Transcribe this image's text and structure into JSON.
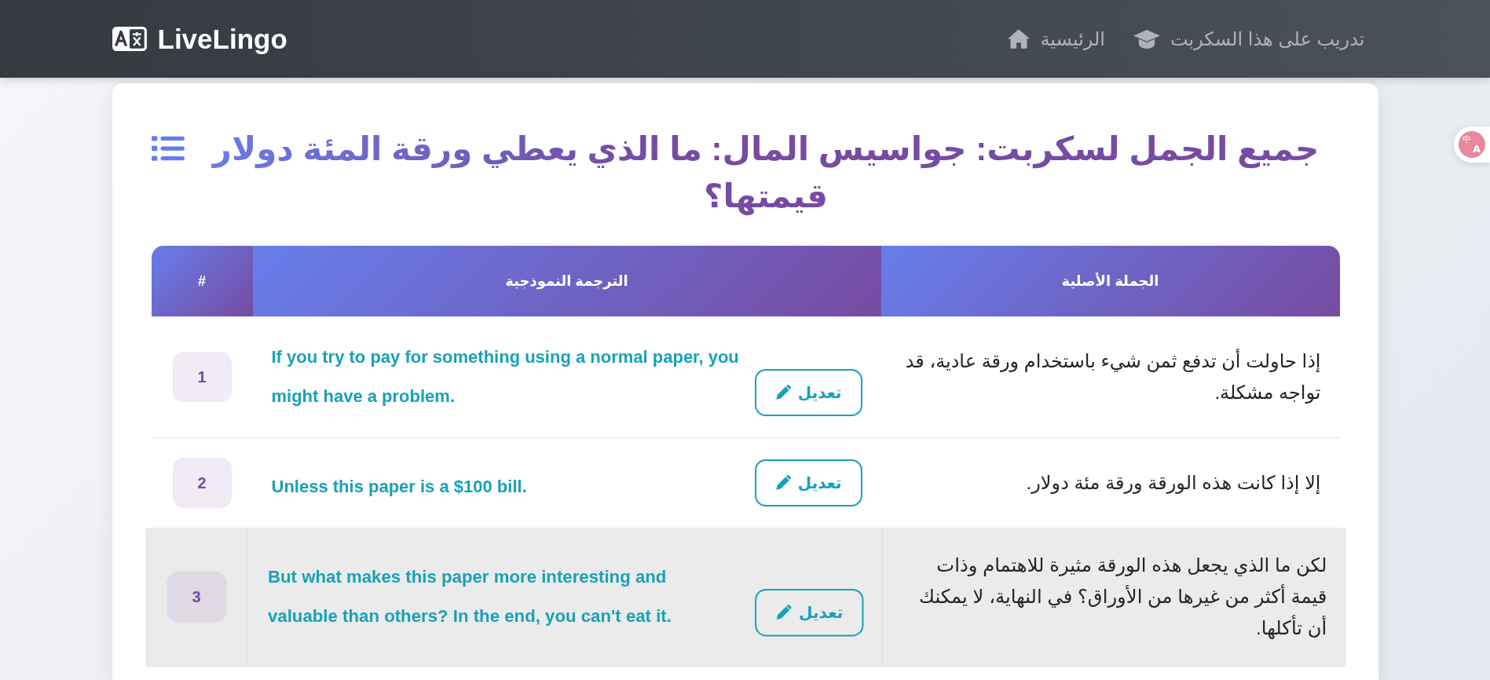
{
  "navbar": {
    "brand": "LiveLingo",
    "links": [
      {
        "kind": "training",
        "label": "تدريب على هذا السكربت"
      },
      {
        "kind": "home",
        "label": "الرئيسية"
      }
    ]
  },
  "page": {
    "title": "جميع الجمل لسكربت: جواسيس المال: ما الذي يعطي ورقة المئة دولار قيمتها؟"
  },
  "table": {
    "columns": [
      "الجملة الأصلية",
      "الترجمة النموذجية",
      "#"
    ],
    "rows": [
      {
        "number": "1",
        "original": "إذا حاولت أن تدفع ثمن شيء باستخدام ورقة عادية، قد تواجه مشكلة.",
        "translation": "If you try to pay for something using a normal paper, you might have a problem.",
        "edit_label": "تعديل",
        "highlighted": false
      },
      {
        "number": "2",
        "original": "إلا إذا كانت هذه الورقة ورقة مئة دولار.",
        "translation": "Unless this paper is a $100 bill.",
        "edit_label": "تعديل",
        "highlighted": false
      },
      {
        "number": "3",
        "original": "لكن ما الذي يجعل هذه الورقة مثيرة للاهتمام وذات قيمة أكثر من غيرها من الأوراق؟ في النهاية، لا يمكنك أن تأكلها.",
        "translation": "But what makes this paper more interesting and valuable than others? In the end, you can't eat it.",
        "edit_label": "تعديل",
        "highlighted": true
      }
    ]
  },
  "translate_widget": {
    "glyphs": [
      "中",
      "A"
    ]
  }
}
